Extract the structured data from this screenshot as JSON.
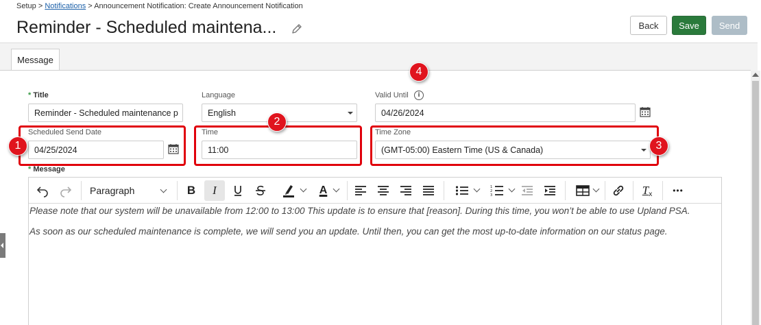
{
  "breadcrumb": {
    "root": "Setup",
    "sep1": ">",
    "link": "Notifications",
    "sep2": ">",
    "current": "Announcement Notification: Create Announcement Notification"
  },
  "page_title": "Reminder - Scheduled maintena...",
  "buttons": {
    "back": "Back",
    "save": "Save",
    "send": "Send"
  },
  "tabs": [
    {
      "label": "Message",
      "active": true
    }
  ],
  "form": {
    "title": {
      "label": "Title",
      "required_mark": "*",
      "value": "Reminder - Scheduled maintenance p"
    },
    "language": {
      "label": "Language",
      "value": "English"
    },
    "valid_until": {
      "label": "Valid Until",
      "value": "04/26/2024",
      "info_glyph": "i"
    },
    "scheduled_send_date": {
      "label": "Scheduled Send Date",
      "value": "04/25/2024"
    },
    "time": {
      "label": "Time",
      "value": "11:00"
    },
    "time_zone": {
      "label": "Time Zone",
      "value": "(GMT-05:00) Eastern Time (US & Canada)"
    },
    "message": {
      "label": "Message",
      "required_mark": "*"
    }
  },
  "callouts": [
    "1",
    "2",
    "3",
    "4"
  ],
  "editor": {
    "block_format": "Paragraph",
    "toolbar_icons": [
      "undo-icon",
      "redo-icon",
      "bold-icon",
      "italic-icon",
      "underline-icon",
      "strikethrough-icon",
      "highlight-color-icon",
      "text-color-icon",
      "align-left-icon",
      "align-center-icon",
      "align-right-icon",
      "justify-icon",
      "bullet-list-icon",
      "numbered-list-icon",
      "outdent-icon",
      "indent-icon",
      "table-icon",
      "link-icon",
      "clear-format-icon",
      "more-icon"
    ],
    "toolbar_glyphs": {
      "bold": "B",
      "italic": "I",
      "text_color": "A",
      "clear_format": "T",
      "clear_format_sub": "x",
      "more": "•••"
    },
    "paragraphs": [
      "Please note that our system will be unavailable from 12:00 to 13:00 This update is to ensure that [reason]. During this time, you won’t be able to use Upland PSA.",
      "As soon as our scheduled maintenance is complete, we will send you an update. Until then, you can get the most up-to-date information on our status page."
    ]
  },
  "colors": {
    "save": "#2a7a3b",
    "send_disabled": "#aebdc7",
    "callout": "#e0141e",
    "link": "#1a5fa8",
    "required": "#3a9a46"
  }
}
